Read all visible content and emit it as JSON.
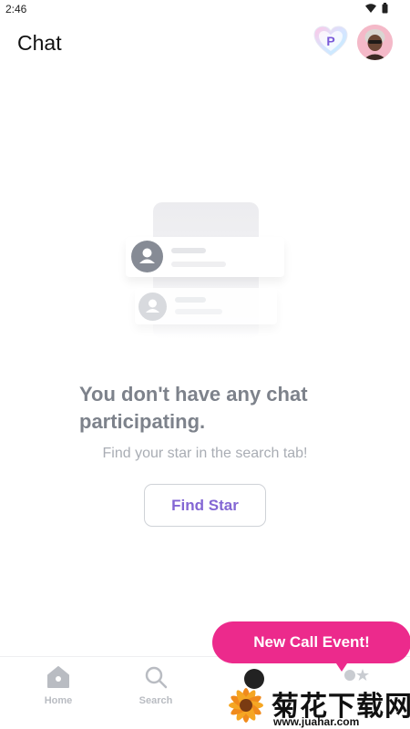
{
  "status_bar": {
    "time": "2:46"
  },
  "header": {
    "title": "Chat",
    "premium_badge_letter": "P"
  },
  "empty_state": {
    "title_line1": "You don't have any chat",
    "title_line2": "participating.",
    "subtitle": "Find your star in the search tab!",
    "button_label": "Find Star"
  },
  "nav": {
    "home_label": "Home",
    "search_label": "Search"
  },
  "event_bubble": {
    "label": "New Call Event!"
  },
  "watermark": {
    "text": "菊花下载网",
    "url": "www.juahar.com"
  },
  "colors": {
    "accent_purple": "#8366d4",
    "event_pink": "#ec2a8c",
    "title_gray": "#7d828b",
    "subtitle_gray": "#a9adb4"
  },
  "icons": [
    "wifi-icon",
    "battery-icon",
    "premium-heart-icon",
    "home-icon",
    "search-icon",
    "chat-icon",
    "star-icon"
  ]
}
